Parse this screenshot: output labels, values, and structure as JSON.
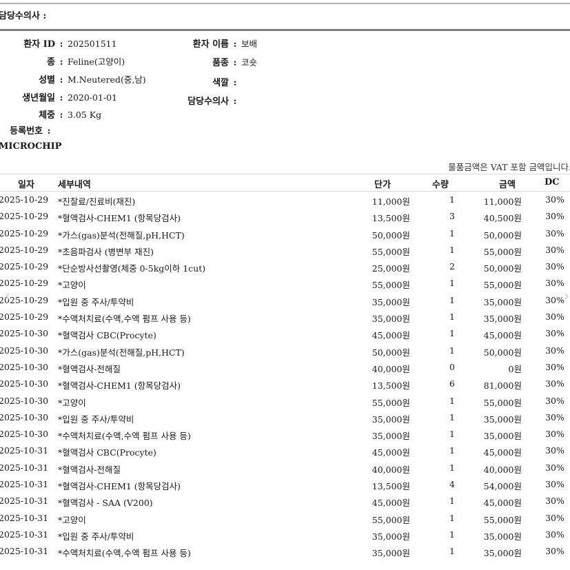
{
  "header": {
    "vet_label": "담당수의사 :"
  },
  "patient": {
    "id_label": "환자 ID",
    "id_value": "202501511",
    "name_label": "환자 이름",
    "name_value": "보배",
    "species_label": "종",
    "species_value": "Feline(고양이)",
    "breed_label": "품종",
    "breed_value": "코숏",
    "sex_label": "성별",
    "sex_value": "M.Neutered(중,남)",
    "color_label": "색깔",
    "color_value": "",
    "birth_label": "생년월일",
    "birth_value": "2020-01-01",
    "vet_label": "담당수의사",
    "vet_value": "",
    "weight_label": "체중",
    "weight_value": "3.05 Kg",
    "reg_label": "등록번호",
    "reg_value": "",
    "chip_label": "MICROCHIP",
    "chip_value": ""
  },
  "vat_note": "물품금액은 VAT 포함 금액입니다.",
  "table": {
    "headers": {
      "date": "일자",
      "desc": "세부내역",
      "price": "단가",
      "qty": "수량",
      "amount": "금액",
      "dc": "DC"
    },
    "rows": [
      {
        "date": "2025-10-29",
        "desc": "*진찰료/진료비(재진)",
        "price": "11,000원",
        "qty": "1",
        "amount": "11,000원",
        "dc": "30%"
      },
      {
        "date": "2025-10-29",
        "desc": "*혈액검사-CHEM1 (항목당검사)",
        "price": "13,500원",
        "qty": "3",
        "amount": "40,500원",
        "dc": "30%"
      },
      {
        "date": "2025-10-29",
        "desc": "*가스(gas)분석(전해질,pH,HCT)",
        "price": "50,000원",
        "qty": "1",
        "amount": "50,000원",
        "dc": "30%"
      },
      {
        "date": "2025-10-29",
        "desc": "*초음파검사 (병변부 재진)",
        "price": "55,000원",
        "qty": "1",
        "amount": "55,000원",
        "dc": "30%"
      },
      {
        "date": "2025-10-29",
        "desc": "*단순방사선촬영(체중 0-5kg이하 1cut)",
        "price": "25,000원",
        "qty": "2",
        "amount": "50,000원",
        "dc": "30%"
      },
      {
        "date": "2025-10-29",
        "desc": "*고양이",
        "price": "55,000원",
        "qty": "1",
        "amount": "55,000원",
        "dc": "30%"
      },
      {
        "date": "2025-10-29",
        "desc": "*입원 중 주사/투약비",
        "price": "35,000원",
        "qty": "1",
        "amount": "35,000원",
        "dc": "30%"
      },
      {
        "date": "2025-10-29",
        "desc": "*수액처치료(수액,수액 펌프 사용 등)",
        "price": "35,000원",
        "qty": "1",
        "amount": "35,000원",
        "dc": "30%"
      },
      {
        "date": "2025-10-30",
        "desc": "*혈액검사 CBC(Procyte)",
        "price": "45,000원",
        "qty": "1",
        "amount": "45,000원",
        "dc": "30%"
      },
      {
        "date": "2025-10-30",
        "desc": "*가스(gas)분석(전해질,pH,HCT)",
        "price": "50,000원",
        "qty": "1",
        "amount": "50,000원",
        "dc": "30%"
      },
      {
        "date": "2025-10-30",
        "desc": "*혈액검사-전해질",
        "price": "40,000원",
        "qty": "0",
        "amount": "0원",
        "dc": "30%"
      },
      {
        "date": "2025-10-30",
        "desc": "*혈액검사-CHEM1 (항목당검사)",
        "price": "13,500원",
        "qty": "6",
        "amount": "81,000원",
        "dc": "30%"
      },
      {
        "date": "2025-10-30",
        "desc": "*고양이",
        "price": "55,000원",
        "qty": "1",
        "amount": "55,000원",
        "dc": "30%"
      },
      {
        "date": "2025-10-30",
        "desc": "*입원 중 주사/투약비",
        "price": "35,000원",
        "qty": "1",
        "amount": "35,000원",
        "dc": "30%"
      },
      {
        "date": "2025-10-30",
        "desc": "*수액처치료(수액,수액 펌프 사용 등)",
        "price": "35,000원",
        "qty": "1",
        "amount": "35,000원",
        "dc": "30%"
      },
      {
        "date": "2025-10-31",
        "desc": "*혈액검사 CBC(Procyte)",
        "price": "45,000원",
        "qty": "1",
        "amount": "45,000원",
        "dc": "30%"
      },
      {
        "date": "2025-10-31",
        "desc": "*혈액검사-전해질",
        "price": "40,000원",
        "qty": "1",
        "amount": "40,000원",
        "dc": "30%"
      },
      {
        "date": "2025-10-31",
        "desc": "*혈액검사-CHEM1 (항목당검사)",
        "price": "13,500원",
        "qty": "4",
        "amount": "54,000원",
        "dc": "30%"
      },
      {
        "date": "2025-10-31",
        "desc": "*혈액검사 - SAA (V200)",
        "price": "45,000원",
        "qty": "1",
        "amount": "45,000원",
        "dc": "30%"
      },
      {
        "date": "2025-10-31",
        "desc": "*고양이",
        "price": "55,000원",
        "qty": "1",
        "amount": "55,000원",
        "dc": "30%"
      },
      {
        "date": "2025-10-31",
        "desc": "*입원 중 주사/투약비",
        "price": "35,000원",
        "qty": "1",
        "amount": "35,000원",
        "dc": "30%"
      },
      {
        "date": "2025-10-31",
        "desc": "*수액처치료(수액,수액 펌프 사용 등)",
        "price": "35,000원",
        "qty": "1",
        "amount": "35,000원",
        "dc": "30%"
      }
    ]
  },
  "nav": {
    "prev_icon": "chevron-left-icon",
    "next_icon": "chevron-right-icon"
  }
}
